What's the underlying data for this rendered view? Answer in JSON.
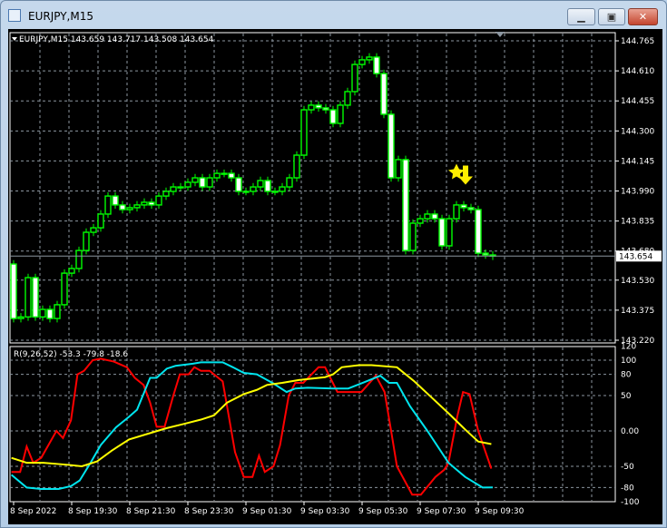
{
  "window": {
    "title": "EURJPY,M15",
    "buttons": [
      "minimize",
      "maximize",
      "close"
    ]
  },
  "colors": {
    "candle": "#00ff00",
    "bear_fill": "#ffffff",
    "bull_fill": "#000000",
    "grid": "#8c96a0",
    "red": "#ff0000",
    "cyan": "#00e5ee",
    "yellow": "#ffff00",
    "arrow": "#ffee00"
  },
  "chart_data": [
    {
      "type": "candlestick",
      "header": "EURJPY,M15 143.659 143.717 143.508 143.654",
      "ylim": [
        143.22,
        144.765
      ],
      "yticks": [
        "144.765",
        "144.610",
        "144.455",
        "144.300",
        "144.145",
        "143.990",
        "143.835",
        "143.680",
        "143.530",
        "143.375",
        "143.220"
      ],
      "current_price": "143.654",
      "first_open": 143.613,
      "closes": [
        143.332,
        143.34,
        143.543,
        143.34,
        143.379,
        143.332,
        143.403,
        143.566,
        143.59,
        143.683,
        143.777,
        143.8,
        143.871,
        143.964,
        143.918,
        143.894,
        143.904,
        143.918,
        143.932,
        143.918,
        143.964,
        143.988,
        144.011,
        144.011,
        144.035,
        144.058,
        144.011,
        144.058,
        144.081,
        144.081,
        144.058,
        143.988,
        143.988,
        144.011,
        144.044,
        143.988,
        143.988,
        144.011,
        144.058,
        144.175,
        144.409,
        144.433,
        144.419,
        144.409,
        144.339,
        144.433,
        144.503,
        144.643,
        144.667,
        144.681,
        144.596,
        144.386,
        144.058,
        144.152,
        143.683,
        143.824,
        143.847,
        143.871,
        143.847,
        143.707,
        143.847,
        143.918,
        143.904,
        143.894,
        143.669,
        143.66,
        143.654
      ],
      "signal": {
        "type": "sell-arrow",
        "bar": 62,
        "icon": "star-icon"
      }
    },
    {
      "type": "line",
      "header": "R(9,26,52) -53.3 -79.8 -18.6",
      "ylim": [
        -100,
        120
      ],
      "yticks": [
        "120",
        "100",
        "80",
        "50",
        "0.00",
        "-50",
        "-80",
        "-100"
      ],
      "ytick_values": [
        120,
        100,
        80,
        50,
        0,
        -50,
        -80,
        -100
      ],
      "series": [
        {
          "color": "#ff0000",
          "points": [
            [
              -0.3,
              -58
            ],
            [
              0.9,
              -58
            ],
            [
              1.8,
              -22
            ],
            [
              2.7,
              -45
            ],
            [
              3.8,
              -38
            ],
            [
              5.9,
              0
            ],
            [
              6.8,
              -10
            ],
            [
              7.9,
              15
            ],
            [
              8.8,
              80
            ],
            [
              9.7,
              85
            ],
            [
              10.9,
              100
            ],
            [
              12,
              102
            ],
            [
              13.8,
              98
            ],
            [
              15.6,
              90
            ],
            [
              16.7,
              75
            ],
            [
              17.9,
              65
            ],
            [
              18.8,
              40
            ],
            [
              19.7,
              6
            ],
            [
              20.8,
              6
            ],
            [
              22,
              50
            ],
            [
              22.9,
              80
            ],
            [
              24.1,
              80
            ],
            [
              24.9,
              90
            ],
            [
              25.8,
              85
            ],
            [
              27,
              85
            ],
            [
              28.8,
              70
            ],
            [
              29.4,
              35
            ],
            [
              30.5,
              -30
            ],
            [
              31.7,
              -65
            ],
            [
              32.9,
              -65
            ],
            [
              33.8,
              -35
            ],
            [
              34.6,
              -58
            ],
            [
              35.8,
              -50
            ],
            [
              36.7,
              -20
            ],
            [
              37.9,
              50
            ],
            [
              38.8,
              68
            ],
            [
              39.9,
              68
            ],
            [
              42,
              90
            ],
            [
              42.9,
              90
            ],
            [
              44.6,
              55
            ],
            [
              47.9,
              55
            ],
            [
              49.9,
              78
            ],
            [
              51.1,
              55
            ],
            [
              52,
              0
            ],
            [
              52.8,
              -50
            ],
            [
              54.9,
              -90
            ],
            [
              56.1,
              -90
            ],
            [
              58.1,
              -65
            ],
            [
              59.3,
              -55
            ],
            [
              59.9,
              -45
            ],
            [
              61.1,
              20
            ],
            [
              61.9,
              55
            ],
            [
              62.8,
              52
            ],
            [
              64,
              0
            ],
            [
              65.8,
              -53.3
            ]
          ]
        },
        {
          "color": "#00e5ee",
          "points": [
            [
              -0.3,
              -62
            ],
            [
              1.8,
              -80
            ],
            [
              3.8,
              -82
            ],
            [
              6.2,
              -82
            ],
            [
              7.9,
              -78
            ],
            [
              9.1,
              -70
            ],
            [
              10.6,
              -45
            ],
            [
              12,
              -20
            ],
            [
              14.1,
              5
            ],
            [
              15.9,
              20
            ],
            [
              17,
              30
            ],
            [
              18.8,
              75
            ],
            [
              19.7,
              75
            ],
            [
              21.1,
              88
            ],
            [
              22.3,
              92
            ],
            [
              24.7,
              95
            ],
            [
              25.8,
              97
            ],
            [
              28.8,
              97
            ],
            [
              30.2,
              90
            ],
            [
              31.7,
              82
            ],
            [
              33.5,
              80
            ],
            [
              35.8,
              67
            ],
            [
              37.6,
              55
            ],
            [
              38.8,
              60
            ],
            [
              40.5,
              61
            ],
            [
              44,
              60
            ],
            [
              46.1,
              60
            ],
            [
              48.1,
              68
            ],
            [
              50.5,
              78
            ],
            [
              51.7,
              68
            ],
            [
              52.8,
              68
            ],
            [
              54.6,
              35
            ],
            [
              57,
              0
            ],
            [
              59.9,
              -45
            ],
            [
              62.2,
              -65
            ],
            [
              64.6,
              -80
            ],
            [
              66,
              -79.8
            ]
          ]
        },
        {
          "color": "#ffff00",
          "points": [
            [
              -0.3,
              -38
            ],
            [
              1.8,
              -45
            ],
            [
              4.1,
              -45
            ],
            [
              7.6,
              -48
            ],
            [
              9.4,
              -50
            ],
            [
              11.5,
              -43
            ],
            [
              13.5,
              -28
            ],
            [
              15.9,
              -12
            ],
            [
              18.5,
              -4
            ],
            [
              21.1,
              4
            ],
            [
              23.5,
              10
            ],
            [
              25.8,
              16
            ],
            [
              27.6,
              22
            ],
            [
              29.4,
              40
            ],
            [
              31.7,
              52
            ],
            [
              33.5,
              58
            ],
            [
              34.9,
              65
            ],
            [
              37,
              68
            ],
            [
              39.3,
              72
            ],
            [
              42.9,
              76
            ],
            [
              44,
              80
            ],
            [
              45.2,
              90
            ],
            [
              47.6,
              93
            ],
            [
              49.3,
              93
            ],
            [
              52.8,
              90
            ],
            [
              55.2,
              70
            ],
            [
              57.5,
              48
            ],
            [
              59.9,
              25
            ],
            [
              62.2,
              2
            ],
            [
              64,
              -15
            ],
            [
              65.8,
              -18.6
            ]
          ]
        }
      ]
    }
  ],
  "time_labels": [
    "8 Sep 2022",
    "8 Sep 19:30",
    "8 Sep 21:30",
    "8 Sep 23:30",
    "9 Sep 01:30",
    "9 Sep 03:30",
    "9 Sep 05:30",
    "9 Sep 07:30",
    "9 Sep 09:30"
  ]
}
